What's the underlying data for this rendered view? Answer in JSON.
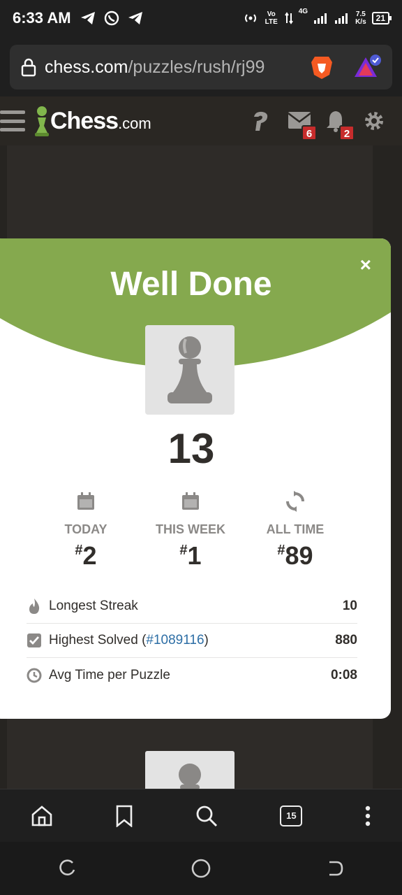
{
  "status_bar": {
    "time": "6:33 AM",
    "net_label": "Vo LTE",
    "net_gen": "4G",
    "speed_value": "7.5",
    "speed_unit": "K/s",
    "battery": "21"
  },
  "browser": {
    "url_domain": "chess.com",
    "url_path": "/puzzles/rush/rj99",
    "tab_count": "15"
  },
  "site_header": {
    "logo_main": "Chess",
    "logo_suffix": ".com",
    "messages_badge": "6",
    "notifications_badge": "2"
  },
  "modal": {
    "title": "Well Done",
    "close_label": "×",
    "score": "13",
    "ranks": [
      {
        "label": "TODAY",
        "hash": "#",
        "value": "2",
        "icon": "calendar-icon"
      },
      {
        "label": "THIS WEEK",
        "hash": "#",
        "value": "1",
        "icon": "calendar-icon"
      },
      {
        "label": "ALL TIME",
        "hash": "#",
        "value": "89",
        "icon": "refresh-icon"
      }
    ],
    "stats": [
      {
        "label": "Longest Streak",
        "value": "10",
        "icon": "flame-icon"
      },
      {
        "label_prefix": "Highest Solved (",
        "link": "#1089116",
        "label_suffix": ")",
        "value": "880",
        "icon": "checkbox-icon"
      },
      {
        "label": "Avg Time per Puzzle",
        "value": "0:08",
        "icon": "clock-icon"
      }
    ]
  },
  "colors": {
    "accent_green": "#85a94e",
    "badge_red": "#c72c2c",
    "link_blue": "#2d6ea5",
    "page_bg": "#2e2b28"
  }
}
